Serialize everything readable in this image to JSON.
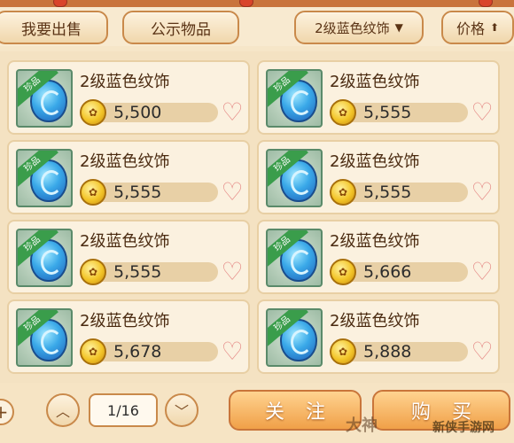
{
  "tabs": {
    "sell": "我要出售",
    "public": "公示物品",
    "filter": "2级蓝色纹饰",
    "sort": "价格"
  },
  "item_badge": "珍品",
  "items": [
    {
      "name": "2级蓝色纹饰",
      "price": "5,500"
    },
    {
      "name": "2级蓝色纹饰",
      "price": "5,555"
    },
    {
      "name": "2级蓝色纹饰",
      "price": "5,555"
    },
    {
      "name": "2级蓝色纹饰",
      "price": "5,555"
    },
    {
      "name": "2级蓝色纹饰",
      "price": "5,555"
    },
    {
      "name": "2级蓝色纹饰",
      "price": "5,666"
    },
    {
      "name": "2级蓝色纹饰",
      "price": "5,678"
    },
    {
      "name": "2级蓝色纹饰",
      "price": "5,888"
    }
  ],
  "pagination": {
    "text": "1/16"
  },
  "actions": {
    "follow": "关注",
    "buy": "购买"
  },
  "watermark": {
    "left": "大神",
    "right": "新侠手游网"
  },
  "icons": {
    "filter_arrow": "triangle-down-icon",
    "sort_arrow": "arrow-up-icon",
    "heart": "heart-icon",
    "coin": "coin-icon",
    "gem": "gem-icon"
  },
  "colors": {
    "accent": "#f0a048",
    "border": "#c9894a",
    "card": "#fbf1df"
  }
}
